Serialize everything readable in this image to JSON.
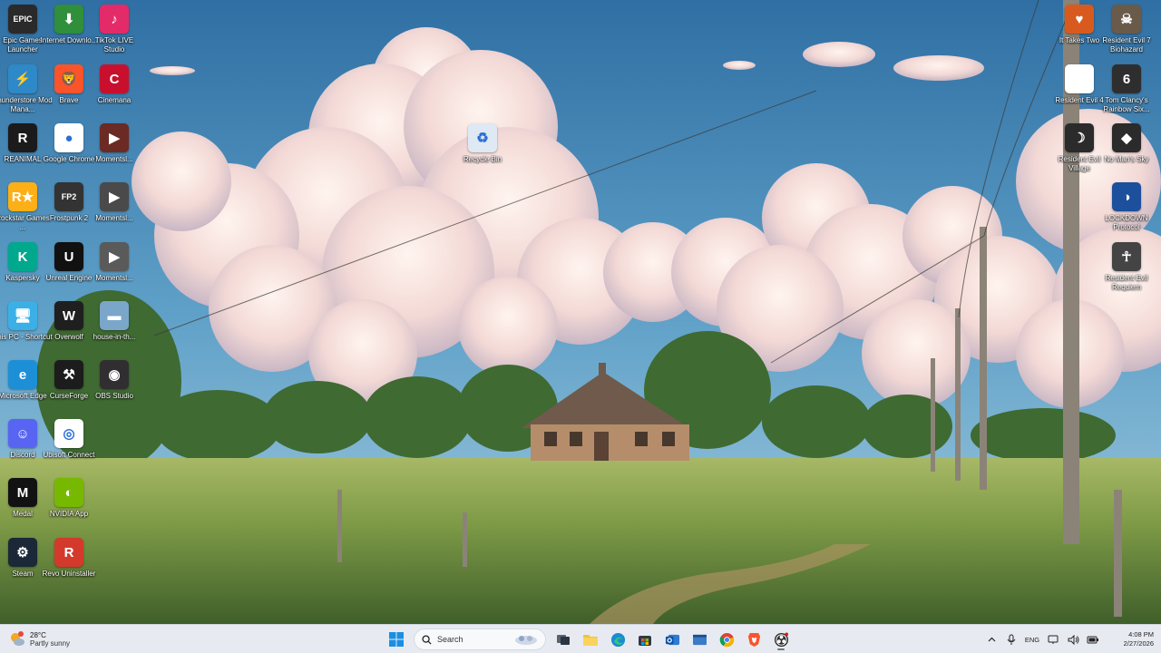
{
  "desktop": {
    "icons": [
      {
        "label": "Epic Games Launcher",
        "icon": "epic-games-icon",
        "color": "#2a2a2a",
        "glyph": "EPIC"
      },
      {
        "label": "Internet Downlo...",
        "icon": "internet-download-manager-icon",
        "color": "#2f8f3a",
        "glyph": "⬇"
      },
      {
        "label": "TikTok LIVE Studio",
        "icon": "tiktok-live-icon",
        "color": "#e32b6a",
        "glyph": "♪"
      },
      {
        "label": "Thunderstore Mod Mana...",
        "icon": "thunderstore-icon",
        "color": "#2d89c8",
        "glyph": "⚡"
      },
      {
        "label": "Brave",
        "icon": "brave-icon",
        "color": "#fb542b",
        "glyph": "🦁"
      },
      {
        "label": "Cinemana",
        "icon": "cinemana-icon",
        "color": "#c8102e",
        "glyph": "C"
      },
      {
        "label": "REANIMAL",
        "icon": "reanimal-icon",
        "color": "#1b1b1b",
        "glyph": "R"
      },
      {
        "label": "Google Chrome",
        "icon": "chrome-icon",
        "color": "#ffffff",
        "glyph": "●"
      },
      {
        "label": "Momentsl...",
        "icon": "moments-video-icon",
        "color": "#6b2a24",
        "glyph": "▶"
      },
      {
        "label": "Rockstar Games ...",
        "icon": "rockstar-games-icon",
        "color": "#fcaf17",
        "glyph": "R★"
      },
      {
        "label": "Frostpunk 2",
        "icon": "frostpunk-icon",
        "color": "#333333",
        "glyph": "FP2"
      },
      {
        "label": "Momentsl...",
        "icon": "moments-video-icon",
        "color": "#4a4a4a",
        "glyph": "▶"
      },
      {
        "label": "Kaspersky",
        "icon": "kaspersky-icon",
        "color": "#00a88e",
        "glyph": "K"
      },
      {
        "label": "Unreal Engine",
        "icon": "unreal-engine-icon",
        "color": "#111111",
        "glyph": "U"
      },
      {
        "label": "Momentsl...",
        "icon": "moments-video-icon",
        "color": "#5a5a5a",
        "glyph": "▶"
      },
      {
        "label": "This PC - Shortcut",
        "icon": "this-pc-icon",
        "color": "#3ab0e6",
        "glyph": "🖥"
      },
      {
        "label": "Overwolf",
        "icon": "overwolf-icon",
        "color": "#1f1f1f",
        "glyph": "W"
      },
      {
        "label": "house-in-th...",
        "icon": "image-file-icon",
        "color": "#7aa6c9",
        "glyph": "▬"
      },
      {
        "label": "Microsoft Edge",
        "icon": "edge-icon",
        "color": "#1d8fd6",
        "glyph": "e"
      },
      {
        "label": "CurseForge",
        "icon": "curseforge-icon",
        "color": "#1c1c1c",
        "glyph": "⚒"
      },
      {
        "label": "OBS Studio",
        "icon": "obs-studio-icon",
        "color": "#302e31",
        "glyph": "◉"
      },
      {
        "label": "Discord",
        "icon": "discord-icon",
        "color": "#5865f2",
        "glyph": "☺"
      },
      {
        "label": "Ubisoft Connect",
        "icon": "ubisoft-connect-icon",
        "color": "#ffffff",
        "glyph": "◎"
      },
      {
        "label": "Medal",
        "icon": "medal-icon",
        "color": "#121212",
        "glyph": "M"
      },
      {
        "label": "NVIDIA App",
        "icon": "nvidia-app-icon",
        "color": "#76b900",
        "glyph": "◐"
      },
      {
        "label": "Steam",
        "icon": "steam-icon",
        "color": "#1b2838",
        "glyph": "⚙"
      },
      {
        "label": "Revo Uninstaller",
        "icon": "revo-uninstaller-icon",
        "color": "#d33a2c",
        "glyph": "R"
      },
      {
        "label": "Recycle Bin",
        "icon": "recycle-bin-icon",
        "color": "#dfe9f3",
        "glyph": "♻"
      },
      {
        "label": "It Takes Two",
        "icon": "it-takes-two-icon",
        "color": "#d85a1f",
        "glyph": "♥"
      },
      {
        "label": "Resident Evil 7 Biohazard",
        "icon": "resident-evil-7-icon",
        "color": "#6a5a4a",
        "glyph": "☠"
      },
      {
        "label": "Resident Evil 4",
        "icon": "file-icon",
        "color": "#ffffff",
        "glyph": ""
      },
      {
        "label": "Tom Clancy's Rainbow Six...",
        "icon": "rainbow-six-icon",
        "color": "#2e2e2e",
        "glyph": "6"
      },
      {
        "label": "Resident Evil Village",
        "icon": "resident-evil-village-icon",
        "color": "#2b2b2b",
        "glyph": "☽"
      },
      {
        "label": "No Man's Sky",
        "icon": "no-mans-sky-icon",
        "color": "#2b2b2b",
        "glyph": "◆"
      },
      {
        "label": "LOCKDOWN Protocol",
        "icon": "lockdown-protocol-icon",
        "color": "#1c4f9c",
        "glyph": "◑"
      },
      {
        "label": "Resident Evil Requiem",
        "icon": "resident-evil-requiem-icon",
        "color": "#444444",
        "glyph": "☥"
      }
    ]
  },
  "taskbar": {
    "weather": {
      "temp": "28°C",
      "condition": "Partly sunny",
      "icon": "partly-sunny-icon"
    },
    "search_placeholder": "Search",
    "apps": [
      {
        "name": "start-button",
        "icon": "windows-icon",
        "active": false
      },
      {
        "name": "task-view-button",
        "icon": "task-view-icon",
        "active": false
      },
      {
        "name": "file-explorer-button",
        "icon": "folder-icon",
        "active": false
      },
      {
        "name": "edge-button",
        "icon": "edge-icon",
        "active": false
      },
      {
        "name": "store-button",
        "icon": "store-icon",
        "active": false
      },
      {
        "name": "outlook-button",
        "icon": "outlook-icon",
        "active": false
      },
      {
        "name": "app-window-button",
        "icon": "app-window-icon",
        "active": false
      },
      {
        "name": "chrome-button",
        "icon": "chrome-icon",
        "active": false
      },
      {
        "name": "brave-button",
        "icon": "brave-icon",
        "active": false
      },
      {
        "name": "obs-button",
        "icon": "obs-studio-icon",
        "active": true
      }
    ],
    "tray": {
      "language": "ENG",
      "time": "4:08 PM",
      "date": "2/27/2026"
    }
  }
}
